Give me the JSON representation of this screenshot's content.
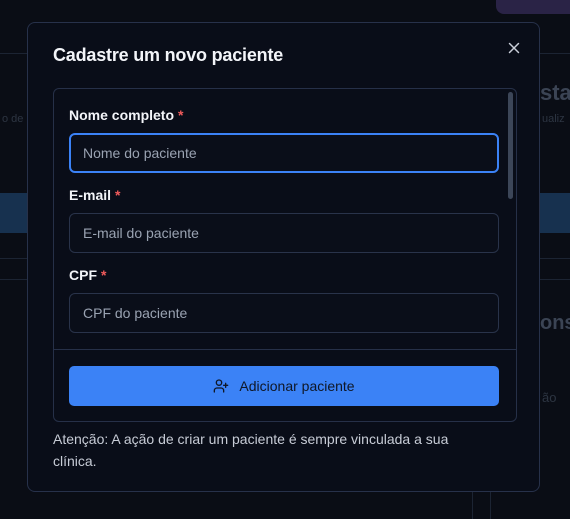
{
  "modal": {
    "title": "Cadastre um novo paciente",
    "close_icon": "close-icon",
    "fields": [
      {
        "label": "Nome completo",
        "required_mark": "*",
        "placeholder": "Nome do paciente",
        "value": ""
      },
      {
        "label": "E-mail",
        "required_mark": "*",
        "placeholder": "E-mail do paciente",
        "value": ""
      },
      {
        "label": "CPF",
        "required_mark": "*",
        "placeholder": "CPF do paciente",
        "value": ""
      }
    ],
    "submit": {
      "label": "Adicionar paciente",
      "icon": "user-plus-icon"
    },
    "notice": "Atenção: A ação de criar um paciente é sempre vinculada a sua clínica."
  },
  "background": {
    "fragments": [
      "sta",
      "o de",
      "ualiz",
      "ons",
      "ão"
    ]
  },
  "colors": {
    "accent": "#3b82f6",
    "required": "#f05b5b",
    "modal_bg": "#090d18",
    "page_bg": "#0a0d15"
  }
}
